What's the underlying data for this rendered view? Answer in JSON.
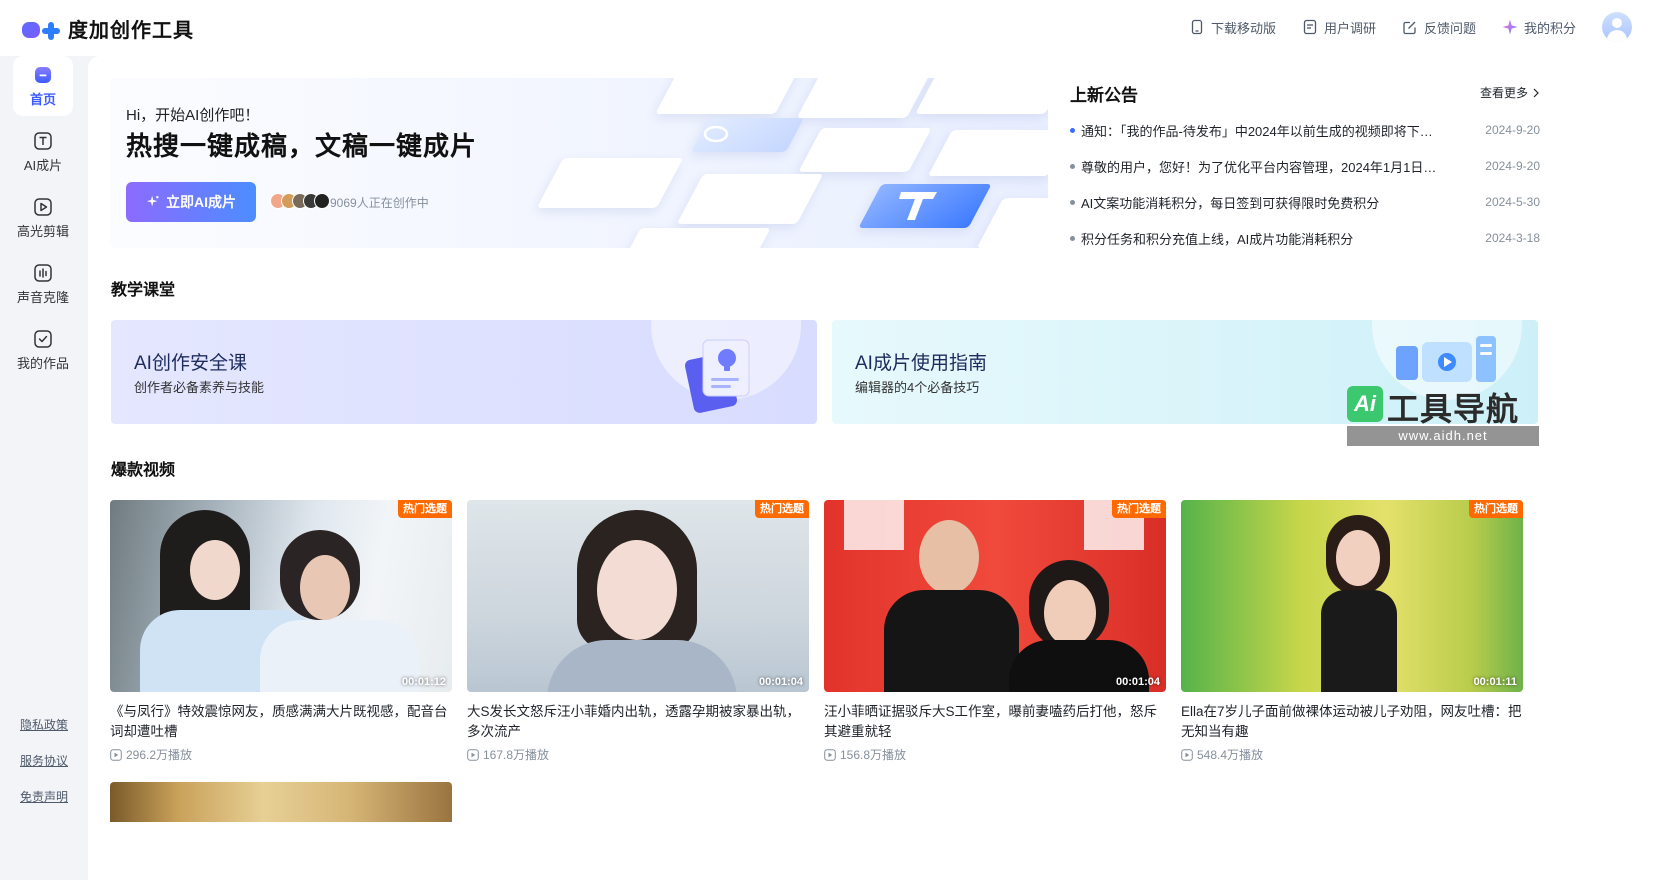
{
  "app": {
    "logo_text": "度加创作工具"
  },
  "header": {
    "actions": [
      {
        "label": "下载移动版",
        "icon": "phone-icon"
      },
      {
        "label": "用户调研",
        "icon": "document-icon"
      },
      {
        "label": "反馈问题",
        "icon": "edit-icon"
      },
      {
        "label": "我的积分",
        "icon": "sparkle-icon"
      }
    ]
  },
  "sidebar": {
    "items": [
      {
        "label": "首页",
        "icon": "home-icon",
        "active": true
      },
      {
        "label": "AI成片",
        "icon": "text-t-icon"
      },
      {
        "label": "高光剪辑",
        "icon": "play-icon"
      },
      {
        "label": "声音克隆",
        "icon": "waveform-icon"
      },
      {
        "label": "我的作品",
        "icon": "checkbox-icon"
      }
    ],
    "footer": [
      "隐私政策",
      "服务协议",
      "免责声明"
    ]
  },
  "hero": {
    "greeting": "Hi，开始AI创作吧！",
    "title": "热搜一键成稿，文稿一键成片",
    "button_label": "立即AI成片",
    "creators_text": "9069人正在创作中"
  },
  "announcements": {
    "title": "上新公告",
    "more_label": "查看更多",
    "items": [
      {
        "text": "通知：「我的作品-待发布」中2024年以前生成的视频即将下…",
        "date": "2024-9-20",
        "new": true
      },
      {
        "text": "尊敬的用户，您好！为了优化平台内容管理，2024年1月1日…",
        "date": "2024-9-20"
      },
      {
        "text": "AI文案功能消耗积分，每日签到可获得限时免费积分",
        "date": "2024-5-30"
      },
      {
        "text": "积分任务和积分充值上线，AI成片功能消耗积分",
        "date": "2024-3-18"
      }
    ]
  },
  "lessons": {
    "section_title": "教学课堂",
    "cards": [
      {
        "title": "AI创作安全课",
        "subtitle": "创作者必备素养与技能"
      },
      {
        "title": "AI成片使用指南",
        "subtitle": "编辑器的4个必备技巧"
      }
    ]
  },
  "watermark": {
    "logo": "Ai",
    "text": "工具导航",
    "url": "www.aidh.net"
  },
  "videos": {
    "section_title": "爆款视频",
    "hot_badge": "热门选题",
    "items": [
      {
        "title": "《与凤行》特效震惊网友，质感满满大片既视感，配音台词却遭吐槽",
        "duration": "00:01:12",
        "plays": "296.2万播放"
      },
      {
        "title": "大S发长文怒斥汪小菲婚内出轨，透露孕期被家暴出轨，多次流产",
        "duration": "00:01:04",
        "plays": "167.8万播放"
      },
      {
        "title": "汪小菲晒证据驳斥大S工作室，曝前妻嗑药后打他，怒斥其避重就轻",
        "duration": "00:01:04",
        "plays": "156.8万播放"
      },
      {
        "title": "Ella在7岁儿子面前做裸体运动被儿子劝阻，网友吐槽：把无知当有趣",
        "duration": "00:01:11",
        "plays": "548.4万播放"
      }
    ]
  }
}
